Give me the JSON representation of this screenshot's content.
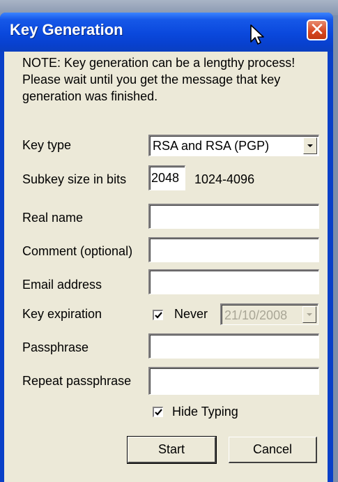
{
  "window": {
    "title": "Key Generation"
  },
  "note": "NOTE: Key generation can be a lengthy process! Please wait until you get the message that key generation was finished.",
  "fields": {
    "key_type": {
      "label": "Key type",
      "value": "RSA and RSA (PGP)"
    },
    "subkey_size": {
      "label": "Subkey size in bits",
      "value": "2048",
      "range": "1024-4096"
    },
    "real_name": {
      "label": "Real name",
      "value": ""
    },
    "comment": {
      "label": "Comment (optional)",
      "value": ""
    },
    "email": {
      "label": "Email address",
      "value": ""
    },
    "key_expiration": {
      "label": "Key expiration",
      "never_label": "Never",
      "never_checked": true,
      "date": "21/10/2008"
    },
    "passphrase": {
      "label": "Passphrase",
      "value": ""
    },
    "repeat_passphrase": {
      "label": "Repeat passphrase",
      "value": ""
    }
  },
  "hide_typing": {
    "label": "Hide Typing",
    "checked": true
  },
  "buttons": {
    "start": "Start",
    "cancel": "Cancel"
  },
  "icons": {
    "close": "close-icon",
    "dropdown": "chevron-down-icon",
    "cursor": "mouse-pointer-icon",
    "check": "checkmark-icon"
  }
}
